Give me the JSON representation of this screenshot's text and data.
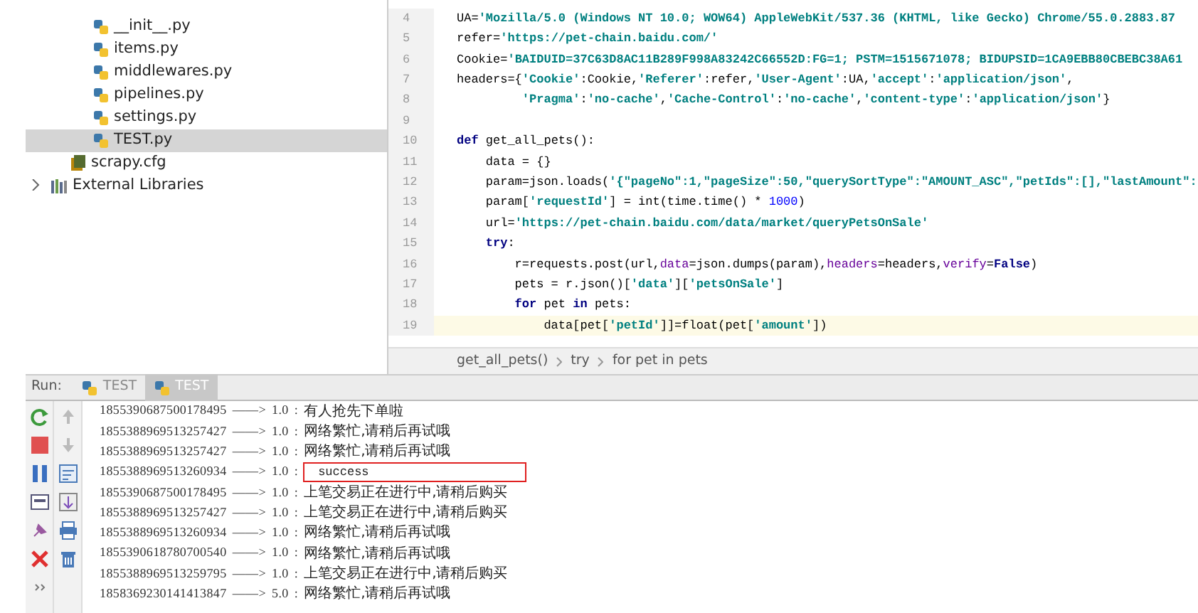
{
  "project_tree": [
    {
      "label": "__init__.py",
      "kind": "python",
      "selected": false
    },
    {
      "label": "items.py",
      "kind": "python",
      "selected": false
    },
    {
      "label": "middlewares.py",
      "kind": "python",
      "selected": false
    },
    {
      "label": "pipelines.py",
      "kind": "python",
      "selected": false
    },
    {
      "label": "settings.py",
      "kind": "python",
      "selected": false
    },
    {
      "label": "TEST.py",
      "kind": "python",
      "selected": true
    },
    {
      "label": "scrapy.cfg",
      "kind": "config",
      "selected": false
    },
    {
      "label": "External Libraries",
      "kind": "library",
      "selected": false,
      "expanded": false
    }
  ],
  "editor": {
    "lines": [
      {
        "number": "4",
        "current": false,
        "tokens": [
          {
            "t": "UA=",
            "kind": "plain"
          },
          {
            "t": "'Mozilla/5.0 (Windows NT 10.0; WOW64) AppleWebKit/537.36 (KHTML, like Gecko) Chrome/55.0.2883.87",
            "kind": "str"
          }
        ]
      },
      {
        "number": "5",
        "current": false,
        "tokens": [
          {
            "t": "refer=",
            "kind": "plain"
          },
          {
            "t": "'https://pet-chain.baidu.com/'",
            "kind": "str"
          }
        ]
      },
      {
        "number": "6",
        "current": false,
        "tokens": [
          {
            "t": "Cookie=",
            "kind": "plain"
          },
          {
            "t": "'BAIDUID=37C63D8AC11B289F998A83242C66552D:FG=1; PSTM=1515671078; BIDUPSID=1CA9EBB80CBEBC38A61",
            "kind": "str"
          }
        ]
      },
      {
        "number": "7",
        "current": false,
        "tokens": [
          {
            "t": "headers={",
            "kind": "plain"
          },
          {
            "t": "'Cookie'",
            "kind": "str"
          },
          {
            "t": ":Cookie,",
            "kind": "plain"
          },
          {
            "t": "'Referer'",
            "kind": "str"
          },
          {
            "t": ":refer,",
            "kind": "plain"
          },
          {
            "t": "'User-Agent'",
            "kind": "str"
          },
          {
            "t": ":UA,",
            "kind": "plain"
          },
          {
            "t": "'accept'",
            "kind": "str"
          },
          {
            "t": ":",
            "kind": "plain"
          },
          {
            "t": "'application/json'",
            "kind": "str"
          },
          {
            "t": ",",
            "kind": "plain"
          }
        ]
      },
      {
        "number": "8",
        "current": false,
        "tokens": [
          {
            "t": "         'Pragma'",
            "kind": "str"
          },
          {
            "t": ":",
            "kind": "plain"
          },
          {
            "t": "'no-cache'",
            "kind": "str"
          },
          {
            "t": ",",
            "kind": "plain"
          },
          {
            "t": "'Cache-Control'",
            "kind": "str"
          },
          {
            "t": ":",
            "kind": "plain"
          },
          {
            "t": "'no-cache'",
            "kind": "str"
          },
          {
            "t": ",",
            "kind": "plain"
          },
          {
            "t": "'content-type'",
            "kind": "str"
          },
          {
            "t": ":",
            "kind": "plain"
          },
          {
            "t": "'application/json'",
            "kind": "str"
          },
          {
            "t": "}",
            "kind": "plain"
          }
        ]
      },
      {
        "number": "9",
        "current": false
      },
      {
        "number": "10",
        "current": false,
        "tokens": [
          {
            "t": "def ",
            "kind": "kw"
          },
          {
            "t": "get_all_pets():",
            "kind": "plain"
          }
        ]
      },
      {
        "number": "11",
        "current": false,
        "tokens": [
          {
            "t": "    data = {}",
            "kind": "plain"
          }
        ]
      },
      {
        "number": "12",
        "current": false,
        "tokens": [
          {
            "t": "    param=json.loads(",
            "kind": "plain"
          },
          {
            "t": "'{\"pageNo\":1,\"pageSize\":50,\"querySortType\":\"AMOUNT_ASC\",\"petIds\":[],\"lastAmount\":",
            "kind": "str"
          }
        ]
      },
      {
        "number": "13",
        "current": false,
        "tokens": [
          {
            "t": "    param[",
            "kind": "plain"
          },
          {
            "t": "'requestId'",
            "kind": "str"
          },
          {
            "t": "] = int(time.time() * ",
            "kind": "plain"
          },
          {
            "t": "1000",
            "kind": "num"
          },
          {
            "t": ")",
            "kind": "plain"
          }
        ]
      },
      {
        "number": "14",
        "current": false,
        "tokens": [
          {
            "t": "    url=",
            "kind": "plain"
          },
          {
            "t": "'https://pet-chain.baidu.com/data/market/queryPetsOnSale'",
            "kind": "str"
          }
        ]
      },
      {
        "number": "15",
        "current": false,
        "tokens": [
          {
            "t": "    try",
            "kind": "kw"
          },
          {
            "t": ":",
            "kind": "plain"
          }
        ]
      },
      {
        "number": "16",
        "current": false,
        "tokens": [
          {
            "t": "        r=requests.post(url,",
            "kind": "plain"
          },
          {
            "t": "data",
            "kind": "param"
          },
          {
            "t": "=json.dumps(param),",
            "kind": "plain"
          },
          {
            "t": "headers",
            "kind": "param"
          },
          {
            "t": "=headers,",
            "kind": "plain"
          },
          {
            "t": "verify",
            "kind": "param"
          },
          {
            "t": "=",
            "kind": "plain"
          },
          {
            "t": "False",
            "kind": "kw"
          },
          {
            "t": ")",
            "kind": "plain"
          }
        ]
      },
      {
        "number": "17",
        "current": false,
        "tokens": [
          {
            "t": "        pets = r.json()[",
            "kind": "plain"
          },
          {
            "t": "'data'",
            "kind": "str"
          },
          {
            "t": "][",
            "kind": "plain"
          },
          {
            "t": "'petsOnSale'",
            "kind": "str"
          },
          {
            "t": "]",
            "kind": "plain"
          }
        ]
      },
      {
        "number": "18",
        "current": false,
        "tokens": [
          {
            "t": "        for ",
            "kind": "kw"
          },
          {
            "t": "pet ",
            "kind": "plain"
          },
          {
            "t": "in ",
            "kind": "kw"
          },
          {
            "t": "pets:",
            "kind": "plain"
          }
        ]
      },
      {
        "number": "19",
        "current": true,
        "tokens": [
          {
            "t": "            data[pet[",
            "kind": "plain"
          },
          {
            "t": "'petId'",
            "kind": "str"
          },
          {
            "t": "]]=float(pet[",
            "kind": "plain"
          },
          {
            "t": "'amount'",
            "kind": "str"
          },
          {
            "t": "])",
            "kind": "plain"
          }
        ]
      }
    ],
    "breadcrumb": [
      "get_all_pets()",
      "try",
      "for pet in pets"
    ]
  },
  "run_panel": {
    "label": "Run:",
    "tabs": [
      {
        "label": "TEST",
        "selected": false
      },
      {
        "label": "TEST",
        "selected": true
      }
    ],
    "output": [
      {
        "id": "1855390687500178495",
        "arrow": "——>",
        "amount": "1.0",
        "separator": ":",
        "message": "有人抢先下单啦",
        "highlighted": false
      },
      {
        "id": "1855388969513257427",
        "arrow": "——>",
        "amount": "1.0",
        "separator": ":",
        "message": "网络繁忙,请稍后再试哦",
        "highlighted": false
      },
      {
        "id": "1855388969513257427",
        "arrow": "——>",
        "amount": "1.0",
        "separator": ":",
        "message": "网络繁忙,请稍后再试哦",
        "highlighted": false
      },
      {
        "id": "1855388969513260934",
        "arrow": "——>",
        "amount": "1.0",
        "separator": ":",
        "message": "success",
        "highlighted": true
      },
      {
        "id": "1855390687500178495",
        "arrow": "——>",
        "amount": "1.0",
        "separator": ":",
        "message": "上笔交易正在进行中,请稍后购买",
        "highlighted": false
      },
      {
        "id": "1855388969513257427",
        "arrow": "——>",
        "amount": "1.0",
        "separator": ":",
        "message": "上笔交易正在进行中,请稍后购买",
        "highlighted": false
      },
      {
        "id": "1855388969513260934",
        "arrow": "——>",
        "amount": "1.0",
        "separator": ":",
        "message": "网络繁忙,请稍后再试哦",
        "highlighted": false
      },
      {
        "id": "1855390618780700540",
        "arrow": "——>",
        "amount": "1.0",
        "separator": ":",
        "message": "网络繁忙,请稍后再试哦",
        "highlighted": false
      },
      {
        "id": "1855388969513259795",
        "arrow": "——>",
        "amount": "1.0",
        "separator": ":",
        "message": "上笔交易正在进行中,请稍后购买",
        "highlighted": false
      },
      {
        "id": "1858369230141413847",
        "arrow": "——>",
        "amount": "5.0",
        "separator": ":",
        "message": "网络繁忙,请稍后再试哦",
        "highlighted": false
      }
    ]
  }
}
